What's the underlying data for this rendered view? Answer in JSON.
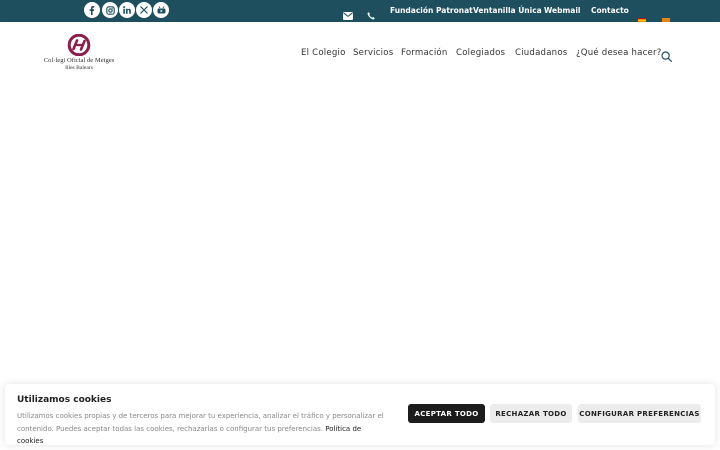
{
  "topbar": {
    "social": [
      {
        "icon": "facebook-icon"
      },
      {
        "icon": "instagram-icon"
      },
      {
        "icon": "linkedin-icon"
      },
      {
        "icon": "x-icon"
      },
      {
        "icon": "youtube-icon"
      }
    ],
    "email_icon": "envelope-icon",
    "phone_icon": "phone-icon",
    "links": [
      "Fundación Patronat",
      "Ventanilla Única",
      "Webmail",
      "Contacto"
    ],
    "languages": [
      {
        "icon": "flag-es-icon",
        "colors": [
          "#c60b1e",
          "#ffc400"
        ]
      },
      {
        "icon": "flag-ca-icon",
        "colors": [
          "#fcdd09",
          "#da121a"
        ]
      }
    ],
    "background": "#1d4f5e"
  },
  "header": {
    "logo": {
      "line1": "Col·legi Oficial de Metges",
      "line2": "Illes Balears",
      "brand_color": "#8b1e4a"
    },
    "nav": [
      "El Colegio",
      "Servicios",
      "Formación",
      "Colegiados",
      "Ciudadanos",
      "¿Qué desea hacer?"
    ],
    "search_icon": "search-icon",
    "accent": "#1d4f5e"
  },
  "cookie_banner": {
    "title": "Utilizamos cookies",
    "text": "Utilizamos cookies propias y de terceros para mejorar tu experiencia, analizar el tráfico y personalizar el contenido. Puedes aceptar todas las cookies, rechazarlas o configurar tus preferencias.",
    "policy_link": "Política de cookies",
    "buttons": {
      "accept": "ACEPTAR TODO",
      "reject": "RECHAZAR TODO",
      "configure": "CONFIGURAR PREFERENCIAS"
    }
  }
}
